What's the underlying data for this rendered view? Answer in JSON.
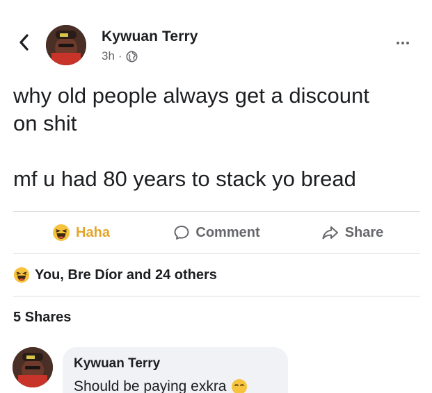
{
  "post": {
    "author": "Kywuan Terry",
    "time": "3h",
    "meta_separator": "·",
    "audience_icon": "globe-icon",
    "text_line_1": "why old people always get a discount",
    "text_line_2": "on shit",
    "text_line_3": "mf u had 80 years to stack yo bread"
  },
  "actions": {
    "haha_label": "Haha",
    "comment_label": "Comment",
    "share_label": "Share"
  },
  "reactions": {
    "summary": "You, Bre Díor and 24 others",
    "icon": "haha-emoji-icon"
  },
  "shares": {
    "label": "5 Shares"
  },
  "comment": {
    "author": "Kywuan Terry",
    "text": "Should be paying exkra",
    "emoji_icon": "smirk-emoji-icon"
  },
  "colors": {
    "haha_accent": "#e4a52a",
    "muted": "#65676b",
    "text": "#1c1e21",
    "bubble": "#f0f2f5"
  }
}
